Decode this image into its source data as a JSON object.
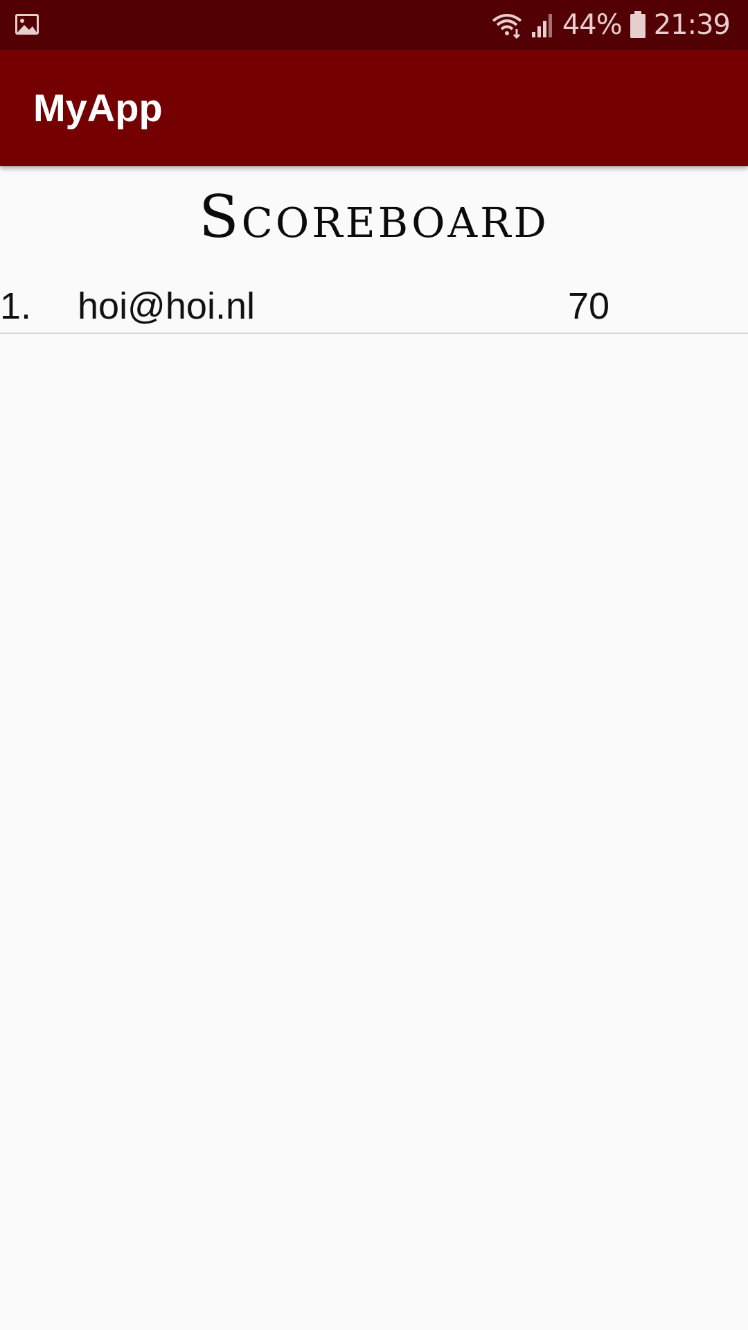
{
  "status_bar": {
    "battery_percent": "44%",
    "time": "21:39",
    "icons": [
      "image-icon",
      "wifi-icon",
      "signal-icon",
      "battery-icon"
    ]
  },
  "app_bar": {
    "title": "MyApp"
  },
  "page": {
    "title": "Scoreboard"
  },
  "scoreboard": {
    "rows": [
      {
        "rank": "1.",
        "email": "hoi@hoi.nl",
        "score": "70"
      }
    ]
  },
  "colors": {
    "status_bar": "#520003",
    "app_bar": "#740002",
    "background": "#fafafa",
    "divider": "#d7d7d7"
  }
}
